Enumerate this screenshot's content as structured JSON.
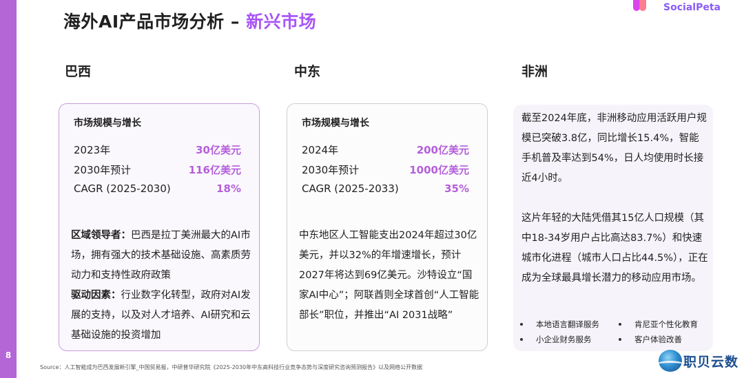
{
  "slide": {
    "title_main": "海外AI产品市场分析 – ",
    "title_accent": "新兴市场",
    "page_number": "8",
    "logo_text": "SocialPeta"
  },
  "regions": {
    "brazil": {
      "name": "巴西",
      "card_heading": "市场规模与增长",
      "metrics": [
        {
          "label": "2023年",
          "value": "30亿美元"
        },
        {
          "label": "2030年预计",
          "value": "116亿美元"
        },
        {
          "label": "CAGR (2025-2030)",
          "value": "18%"
        }
      ],
      "lead_label": "区域领导者：",
      "lead_text": "巴西是拉丁美洲最大的AI市场，拥有强大的技术基础设施、高素质劳动力和支持性政府政策",
      "drivers_label": "驱动因素：",
      "drivers_text": "行业数字化转型，政府对AI发展的支持，以及对人才培养、AI研究和云基础设施的投资增加"
    },
    "middle_east": {
      "name": "中东",
      "card_heading": "市场规模与增长",
      "metrics": [
        {
          "label": "2024年",
          "value": "200亿美元"
        },
        {
          "label": "2030年预计",
          "value": "1000亿美元"
        },
        {
          "label": "CAGR (2025-2033)",
          "value": "35%"
        }
      ],
      "text": "中东地区人工智能支出2024年超过30亿美元，并以32%的年增速增长，预计2027年将达到69亿美元。沙特设立“国家AI中心”；阿联酋则全球首创“人工智能部长”职位，并推出“AI 2031战略”"
    },
    "africa": {
      "name": "非洲",
      "text1": "截至2024年底，非洲移动应用活跃用户规模已突破3.8亿，同比增长15.4%，智能手机普及率达到54%，日人均使用时长接近4小时。",
      "text2": "这片年轻的大陆凭借其15亿人口规模（其中18-34岁用户占比高达83.7%）和快速城市化进程（城市人口占比44.5%），正在成为全球最具增长潜力的移动应用市场。",
      "bullets": [
        "本地语言翻译服务",
        "肯尼亚个性化教育",
        "小企业财务服务",
        "客户体验改善"
      ]
    }
  },
  "footer": {
    "source": "Source：人工智能成为巴西发展新引擎_中国贸易报，中研普华研究院《2025-2030年中东高科技行业竞争态势与深度研究咨询预测报告》以及网络公开数据",
    "brand": "职贝云数"
  }
}
